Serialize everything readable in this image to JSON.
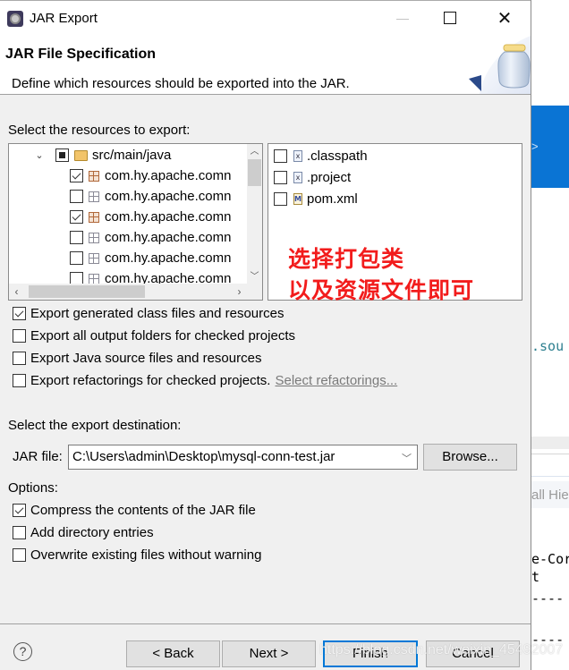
{
  "window": {
    "title": "JAR Export",
    "minimize_label": "",
    "close_glyph": "✕"
  },
  "header": {
    "title": "JAR File Specification",
    "description": "Define which resources should be exported into the JAR."
  },
  "resources": {
    "label": "Select the resources to export:",
    "tree": [
      {
        "label": "src/main/java",
        "type": "source-folder",
        "state": "partial",
        "expanded": true
      },
      {
        "label": "com.hy.apache.comn",
        "type": "package",
        "state": "checked"
      },
      {
        "label": "com.hy.apache.comn",
        "type": "package",
        "state": "unchecked"
      },
      {
        "label": "com.hy.apache.comn",
        "type": "package",
        "state": "checked"
      },
      {
        "label": "com.hy.apache.comn",
        "type": "package",
        "state": "unchecked"
      },
      {
        "label": "com.hy.apache.comn",
        "type": "package",
        "state": "unchecked"
      },
      {
        "label": "com.hy.apache.comn",
        "type": "package",
        "state": "unchecked"
      }
    ],
    "files": [
      {
        "label": ".classpath",
        "icon": "x",
        "checked": false
      },
      {
        "label": ".project",
        "icon": "x",
        "checked": false
      },
      {
        "label": "pom.xml",
        "icon": "M",
        "checked": false
      }
    ]
  },
  "annotation": {
    "line1": "选择打包类",
    "line2": "以及资源文件即可",
    "color": "#f21c1c"
  },
  "export_options": [
    {
      "label": "Export generated class files and resources",
      "checked": true
    },
    {
      "label": "Export all output folders for checked projects",
      "checked": false
    },
    {
      "label": "Export Java source files and resources",
      "checked": false
    },
    {
      "label": "Export refactorings for checked projects.",
      "checked": false,
      "link": "Select refactorings..."
    }
  ],
  "destination": {
    "label": "Select the export destination:",
    "jar_label": "JAR file:",
    "jar_value": "C:\\Users\\admin\\Desktop\\mysql-conn-test.jar",
    "browse_label": "Browse..."
  },
  "options": {
    "label": "Options:",
    "items": [
      {
        "label": "Compress the contents of the JAR file",
        "checked": true
      },
      {
        "label": "Add directory entries",
        "checked": false
      },
      {
        "label": "Overwrite existing files without warning",
        "checked": false
      }
    ]
  },
  "footer": {
    "help_glyph": "?",
    "back_label": "< Back",
    "next_label": "Next >",
    "finish_label": "Finish",
    "cancel_label": "Cancel"
  },
  "background": {
    "chevron": ">",
    "text_sou": ".sou",
    "text_hie": "all Hie",
    "code_lines": "e-Cor\nt",
    "dashes": "----"
  },
  "watermark": "https://blog.csdn.net/weixin_45492007",
  "colors": {
    "accent": "#0078d7",
    "dialog_bg": "#f0f0f0",
    "bg_blue": "#0a74d4"
  }
}
